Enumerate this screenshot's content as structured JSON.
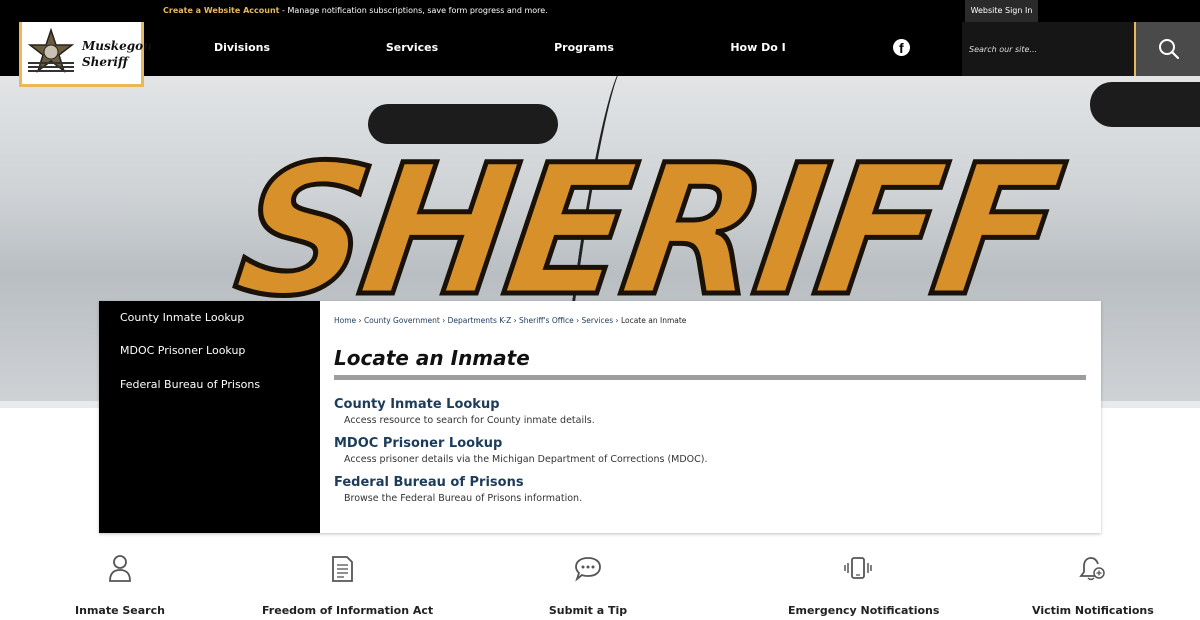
{
  "topbar": {
    "create_account": "Create a Website Account",
    "create_desc": " - Manage notification subscriptions, save form progress and more.",
    "sign_in": "Website Sign In"
  },
  "logo": {
    "line1": "Muskegon",
    "line2": "Sheriff"
  },
  "nav": [
    "Divisions",
    "Services",
    "Programs",
    "How Do I"
  ],
  "search": {
    "placeholder": "Search our site..."
  },
  "hero": {
    "text": "SHERIFF"
  },
  "sidenav": [
    "County Inmate Lookup",
    "MDOC Prisoner Lookup",
    "Federal Bureau of Prisons"
  ],
  "breadcrumb": [
    "Home",
    "County Government",
    "Departments K-Z",
    "Sheriff's Office",
    "Services",
    "Locate an Inmate"
  ],
  "page_title": "Locate an Inmate",
  "resources": [
    {
      "title": "County Inmate Lookup",
      "desc": "Access resource to search for County inmate details."
    },
    {
      "title": "MDOC Prisoner Lookup",
      "desc": "Access prisoner details via the Michigan Department of Corrections (MDOC)."
    },
    {
      "title": "Federal Bureau of Prisons",
      "desc": "Browse the Federal Bureau of Prisons information."
    }
  ],
  "quick_links": [
    {
      "label": "Inmate Search",
      "icon": "person-icon"
    },
    {
      "label": "Freedom of Information Act",
      "icon": "document-icon"
    },
    {
      "label": "Submit a Tip",
      "icon": "chat-bubble-icon"
    },
    {
      "label": "Emergency Notifications",
      "icon": "phone-vibrate-icon"
    },
    {
      "label": "Victim Notifications",
      "icon": "bell-plus-icon"
    }
  ],
  "colors": {
    "accent": "#e8b85a",
    "link": "#1c3c5a",
    "header_bg": "#000000"
  }
}
